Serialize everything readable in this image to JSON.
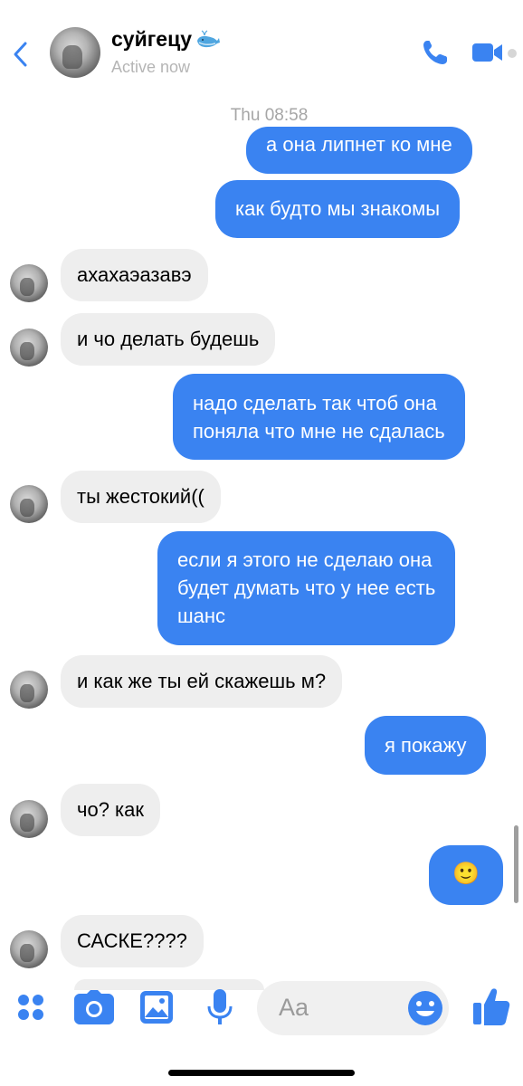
{
  "header": {
    "contact_name": "суйгецу",
    "name_emoji": "whale-icon",
    "status": "Active now",
    "back_icon": "chevron-left-icon",
    "call_icon": "phone-icon",
    "video_icon": "video-camera-icon"
  },
  "conversation": {
    "timestamp": "Thu 08:58",
    "messages": [
      {
        "from": "me",
        "text": "а она липнет ко мне"
      },
      {
        "from": "me",
        "text": "как будто мы знакомы"
      },
      {
        "from": "them",
        "text": "ахахаэазавэ"
      },
      {
        "from": "them",
        "text": "и чо делать будешь"
      },
      {
        "from": "me",
        "lines": [
          "надо сделать так чтоб она",
          "поняла что мне не сдалась"
        ]
      },
      {
        "from": "them",
        "text": "ты жестокий(("
      },
      {
        "from": "me",
        "lines": [
          "если я этого не сделаю она",
          "будет думать что у нее есть",
          "шанс"
        ]
      },
      {
        "from": "them",
        "text": "и как же ты ей скажешь м?"
      },
      {
        "from": "me",
        "text": "я покажу"
      },
      {
        "from": "them",
        "text": "чо? как"
      },
      {
        "from": "me",
        "text": "🙂"
      },
      {
        "from": "them",
        "text": "САСКЕ????"
      }
    ]
  },
  "composer": {
    "placeholder": "Aa",
    "icons": [
      "apps-grid-icon",
      "camera-icon",
      "photo-icon",
      "microphone-icon",
      "emoji-icon",
      "thumbs-up-icon"
    ]
  },
  "colors": {
    "accent": "#3a83f1",
    "incoming_bubble": "#eeeeee",
    "status_gray": "#b5b5b5"
  }
}
